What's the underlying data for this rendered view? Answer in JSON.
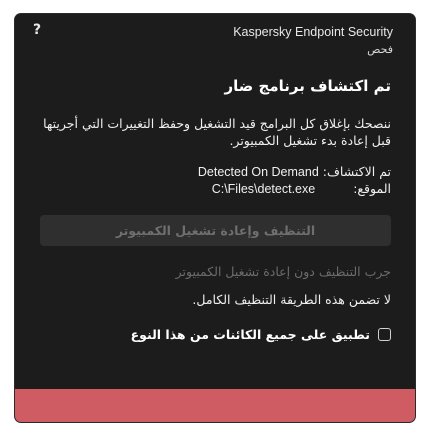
{
  "window": {
    "help_symbol": "?",
    "app_title": "Kaspersky Endpoint Security",
    "app_subtitle": "فحص"
  },
  "content": {
    "heading": "تم اكتشاف برنامج ضار",
    "description": "ننصحك بإغلاق كل البرامج قيد التشغيل وحفظ التغييرات التي أجريتها قبل إعادة بدء تشغيل الكمبيوتر.",
    "detection_label": "تم الاكتشاف:",
    "detection_value": "Detected On Demand",
    "location_label": "الموقع:",
    "location_value": "C:\\Files\\detect.exe"
  },
  "actions": {
    "primary_button": "التنظيف وإعادة تشغيل الكمبيوتر",
    "secondary_link": "جرب التنظيف دون إعادة تشغيل الكمبيوتر",
    "note": "لا تضمن هذه الطريقة التنظيف الكامل.",
    "checkbox_label": "تطبيق على جميع الكائنات من هذا النوع",
    "checkbox_checked": false
  },
  "colors": {
    "window_bg": "#1c1c1c",
    "button_bg": "#2f2f2f",
    "disabled_text": "#6c6c6c",
    "status_band": "#cf5b63"
  }
}
